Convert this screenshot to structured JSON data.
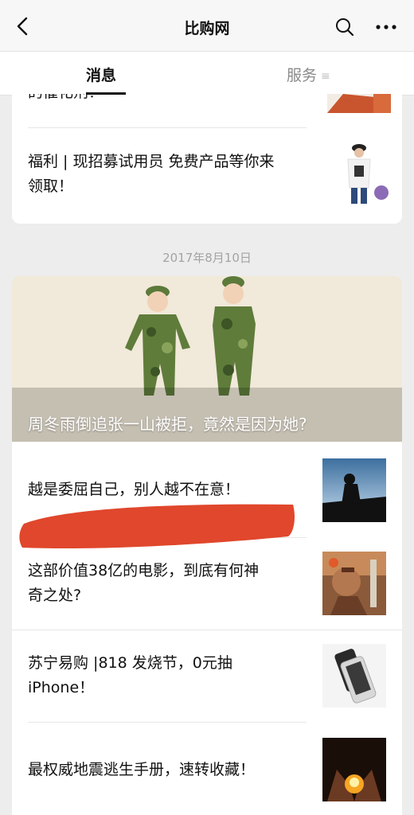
{
  "nav": {
    "title": "比购网"
  },
  "tabs": {
    "messages": "消息",
    "services": "服务"
  },
  "card1": {
    "partial_title": "的催化剂？",
    "item": {
      "title": "福利 | 现招募试用员 免费产品等你来领取！",
      "line1": "福利 | 现招募试用员 免费产品等你来",
      "line2": "领取！"
    }
  },
  "date": "2017年8月10日",
  "card2": {
    "cover_title": "周冬雨倒追张一山被拒，竟然是因为她?",
    "items": [
      {
        "line1": "越是委屈自己，别人越不在意！",
        "line2": ""
      },
      {
        "line1": "这部价值38亿的电影，到底有何神",
        "line2": "奇之处?"
      },
      {
        "line1": "苏宁易购 |818 发烧节，0元抽",
        "line2": "iPhone！"
      },
      {
        "line1": "最权威地震逃生手册，速转收藏！",
        "line2": ""
      }
    ]
  },
  "colors": {
    "nav_bg": "#f7f7f7",
    "page_bg": "#ededed",
    "redact": "#e0472c"
  },
  "icons": [
    "back-arrow-icon",
    "search-icon",
    "more-icon",
    "menu-lines-icon"
  ]
}
